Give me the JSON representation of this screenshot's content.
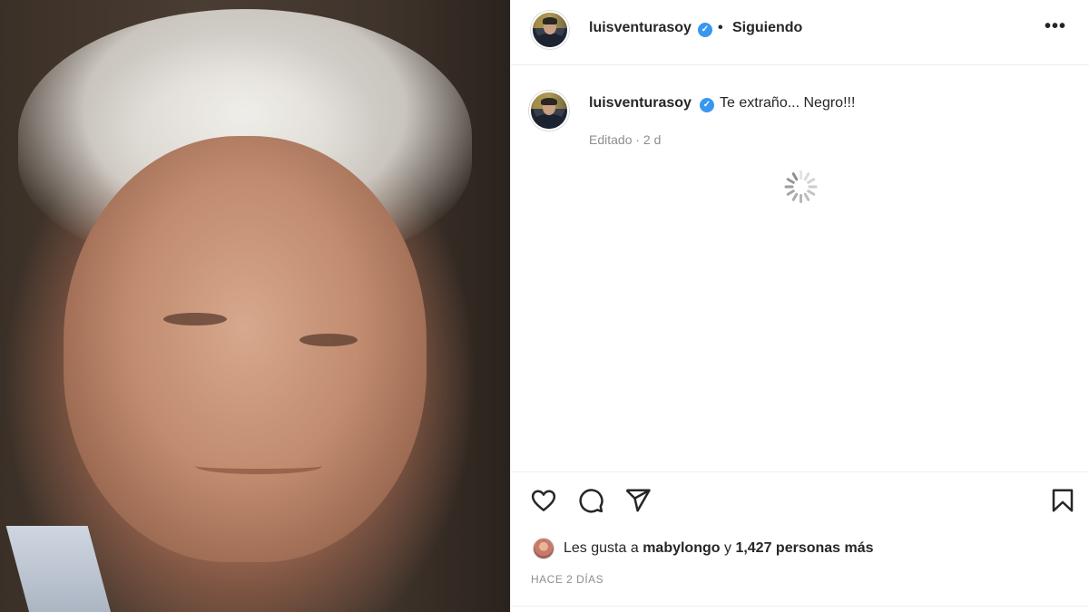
{
  "post": {
    "photo_alt": "photo-elderly-man-gray-hair",
    "header": {
      "username": "luisventurasoy",
      "verified_icon": "verified-badge-icon",
      "separator": "•",
      "follow_status": "Siguiendo",
      "more_icon": "•••"
    },
    "caption": {
      "username": "luisventurasoy",
      "text": "Te extraño... Negro!!!",
      "meta": "Editado · 2 d"
    },
    "actions": {
      "like_icon": "heart-icon",
      "comment_icon": "comment-icon",
      "share_icon": "send-icon",
      "save_icon": "bookmark-icon"
    },
    "likes": {
      "prefix": "Les gusta a",
      "user": "mabylongo",
      "joiner": "y",
      "count": "1,427 personas más"
    },
    "timestamp": "Hace 2 días"
  },
  "colors": {
    "verified_blue": "#3897f0",
    "muted_text": "#8e8e8e",
    "primary_text": "#262626",
    "divider": "#efefef"
  }
}
